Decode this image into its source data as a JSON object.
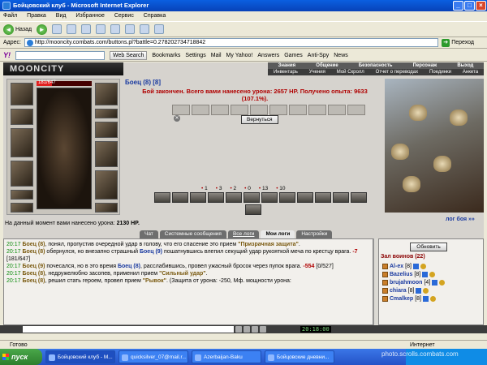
{
  "window": {
    "title": "Бойцовский клуб - Microsoft Internet Explorer"
  },
  "menu": [
    "Файл",
    "Правка",
    "Вид",
    "Избранное",
    "Сервис",
    "Справка"
  ],
  "toolbar": {
    "back_label": "Назад"
  },
  "address": {
    "label": "Адрес:",
    "url": "http://mooncity.combats.com/buttons.pl?battle=0.278202734718842",
    "go_label": "Переход"
  },
  "yahoo": {
    "logo": "Y!",
    "search_btn": "Web Search",
    "bookmarks": "Bookmarks",
    "settings": "Settings",
    "mail": "Mail",
    "my_yahoo": "My Yahoo!",
    "answers": "Answers",
    "games": "Games",
    "antispy": "Anti-Spy",
    "news": "News"
  },
  "site": {
    "logo": "MOONCITY",
    "nav_top": [
      "Знания",
      "Общение",
      "Безопасность",
      "Персонаж",
      "Выход"
    ],
    "nav_bottom": [
      "Инвентарь",
      "Учения",
      "Мой Скролл",
      "Отчет о переводах",
      "Поединки",
      "Анкета"
    ]
  },
  "character": {
    "hp_text": "181/647",
    "hp_fraction": 0.28
  },
  "battle": {
    "fighter": "Боец (8) [8]",
    "result_line1": "Бой закончен. Всего вами нанесено урона: 2657 HP. Получено опыта: 9633",
    "result_line2": "(107.1%).",
    "return_label": "Вернуться",
    "counters": [
      "1",
      "3",
      "2",
      "0",
      "13",
      "10"
    ]
  },
  "damage": {
    "label": "На данный момент вами нанесено урона:",
    "value": "2130 HP."
  },
  "log_link": "лог боя »»",
  "tabs": [
    "Чат",
    "Системные сообщения",
    "Все логи",
    "Мои логи",
    "Настройки"
  ],
  "chat": [
    {
      "time": "20:17",
      "name": "Боец (8)",
      "text": ", понял, пропустив очередной удар в голову, что его спасение это прием ",
      "bold": "\"Призрачная защита\"",
      "tail": "."
    },
    {
      "time": "20:17",
      "name": "Боец (8)",
      "text": " обернулся, но внезапно страшный ",
      "name2": "Боец (9)",
      "text2": " пошатнувшись влепил секущий удар рукояткой меча по крестцу врага. ",
      "dmg": "-7",
      "tail": " [181/647]"
    },
    {
      "time": "20:17",
      "name": "Боец (9)",
      "text": " почесался, но в это время ",
      "name2": "Боец (8)",
      "text2": ", расслабившись, провел ужасный бросок через пупок врага. ",
      "dmg": "-554",
      "tail": " [0/527]"
    },
    {
      "time": "20:17",
      "name": "Боец (8)",
      "text": ", недружелюбно засопев, применил прием ",
      "bold": "\"Сильный удар\"",
      "tail": "."
    },
    {
      "time": "20:17",
      "name": "Боец (8)",
      "text": ", решил стать героем, провел прием ",
      "bold": "\"Рывок\"",
      "tail": ". (Защита от урона: -250, Мф. мощности урона:"
    }
  ],
  "sidebar": {
    "refresh_label": "Обновить",
    "hall_label": "Зал воинов (22)",
    "players": [
      {
        "name": "Al-ex",
        "level": "[8]"
      },
      {
        "name": "Bazelius",
        "level": "[8]"
      },
      {
        "name": "brujahmoon",
        "level": "[4]"
      },
      {
        "name": "chiara",
        "level": "[8]"
      },
      {
        "name": "Cmalkep",
        "level": "[8]"
      }
    ]
  },
  "clock": "20:18:00",
  "status": {
    "left": "Готово",
    "zone": "Интернет"
  },
  "taskbar": {
    "start": "пуск",
    "tasks": [
      "Бойцовский клуб - M...",
      "quicksilver_07@mail.r...",
      "Azerbaijan-Baku",
      "Бойцовские дневни..."
    ]
  },
  "watermark": "photo.scrolls.combats.com",
  "colors": {
    "titlebar": "#0a5fe0",
    "result": "#b00000",
    "fighter": "#1a3aa0"
  }
}
